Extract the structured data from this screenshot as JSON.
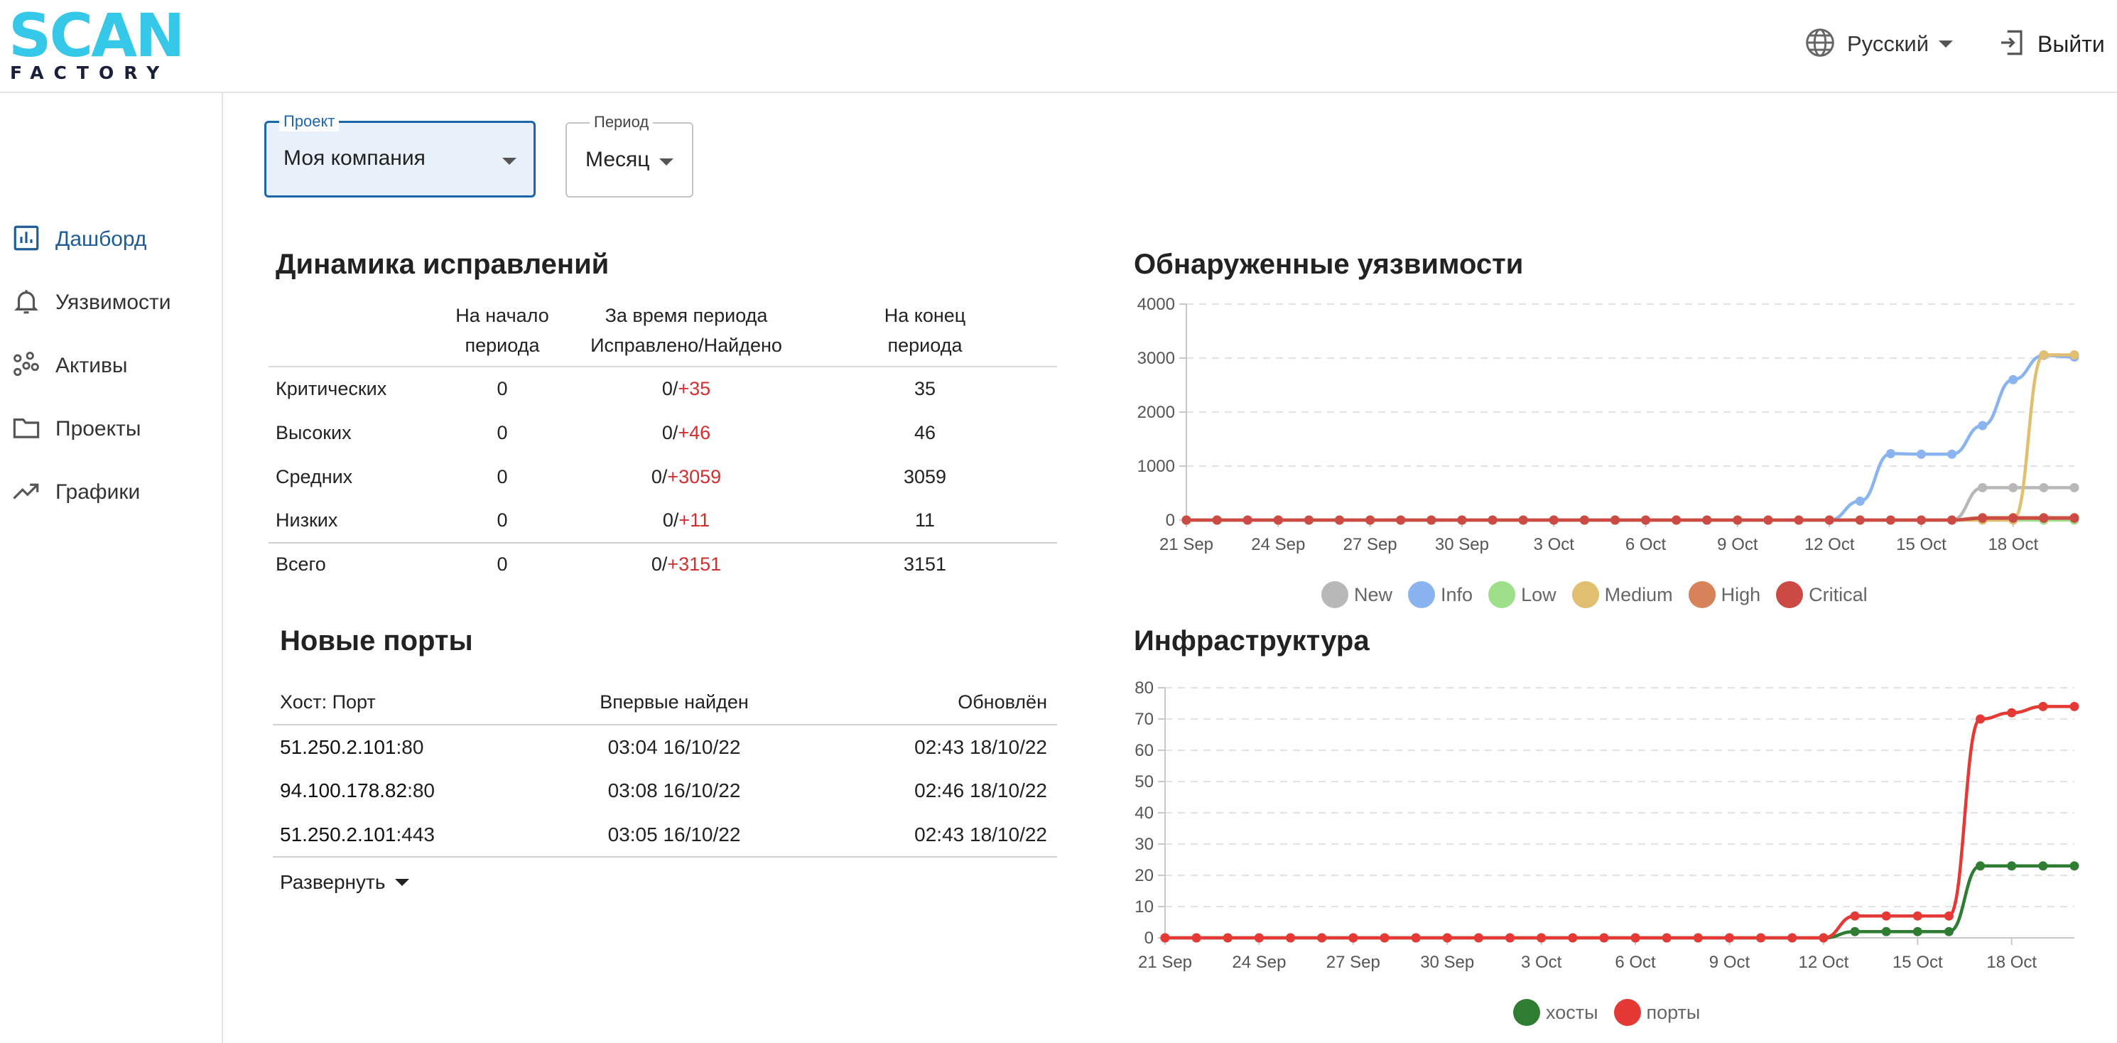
{
  "brand": {
    "name_top": "SCAN",
    "name_bottom": "FACTORY"
  },
  "header": {
    "language": "Русский",
    "logout": "Выйти"
  },
  "sidebar": {
    "items": [
      {
        "label": "Дашборд",
        "icon": "bar-chart-icon",
        "active": true
      },
      {
        "label": "Уязвимости",
        "icon": "bell-icon",
        "active": false
      },
      {
        "label": "Активы",
        "icon": "nodes-icon",
        "active": false
      },
      {
        "label": "Проекты",
        "icon": "folder-icon",
        "active": false
      },
      {
        "label": "Графики",
        "icon": "trending-up-icon",
        "active": false
      }
    ]
  },
  "filters": {
    "project": {
      "label": "Проект",
      "value": "Моя компания"
    },
    "period": {
      "label": "Период",
      "value": "Месяц"
    }
  },
  "remediation": {
    "title": "Динамика исправлений",
    "headers": {
      "start_line1": "На начало",
      "start_line2": "периода",
      "during_line1": "За время периода",
      "during_line2": "Исправлено/Найдено",
      "end_line1": "На конец",
      "end_line2": "периода"
    },
    "rows": [
      {
        "label": "Критических",
        "start": "0",
        "fixed": "0/",
        "found": "+35",
        "end": "35"
      },
      {
        "label": "Высоких",
        "start": "0",
        "fixed": "0/",
        "found": "+46",
        "end": "46"
      },
      {
        "label": "Средних",
        "start": "0",
        "fixed": "0/",
        "found": "+3059",
        "end": "3059"
      },
      {
        "label": "Низких",
        "start": "0",
        "fixed": "0/",
        "found": "+11",
        "end": "11"
      }
    ],
    "total": {
      "label": "Всего",
      "start": "0",
      "fixed": "0/",
      "found": "+3151",
      "end": "3151"
    }
  },
  "ports": {
    "title": "Новые порты",
    "headers": {
      "host_port": "Хост: Порт",
      "first_found": "Впервые найден",
      "updated": "Обновлён"
    },
    "rows": [
      {
        "host": "51.250.2.101",
        "port": ":80",
        "first_found": "03:04 16/10/22",
        "updated": "02:43 18/10/22"
      },
      {
        "host": "94.100.178.82",
        "port": ":80",
        "first_found": "03:08 16/10/22",
        "updated": "02:46 18/10/22"
      },
      {
        "host": "51.250.2.101",
        "port": ":443",
        "first_found": "03:05 16/10/22",
        "updated": "02:43 18/10/22"
      }
    ],
    "expand_label": "Развернуть"
  },
  "chart_data": [
    {
      "title": "Обнаруженные уязвимости",
      "type": "line",
      "x": [
        "21 Sep",
        "22 Sep",
        "23 Sep",
        "24 Sep",
        "25 Sep",
        "26 Sep",
        "27 Sep",
        "28 Sep",
        "29 Sep",
        "30 Sep",
        "1 Oct",
        "2 Oct",
        "3 Oct",
        "4 Oct",
        "5 Oct",
        "6 Oct",
        "7 Oct",
        "8 Oct",
        "9 Oct",
        "10 Oct",
        "11 Oct",
        "12 Oct",
        "13 Oct",
        "14 Oct",
        "15 Oct",
        "16 Oct",
        "17 Oct",
        "18 Oct",
        "19 Oct",
        "20 Oct"
      ],
      "xtick_labels": [
        "21 Sep",
        "24 Sep",
        "27 Sep",
        "30 Sep",
        "3 Oct",
        "6 Oct",
        "9 Oct",
        "12 Oct",
        "15 Oct",
        "18 Oct"
      ],
      "ylim": [
        0,
        4000
      ],
      "yticks": [
        0,
        1000,
        2000,
        3000,
        4000
      ],
      "grid": true,
      "legend_position": "bottom",
      "series": [
        {
          "name": "New",
          "color": "#b8b8b8",
          "values": [
            0,
            0,
            0,
            0,
            0,
            0,
            0,
            0,
            0,
            0,
            0,
            0,
            0,
            0,
            0,
            0,
            0,
            0,
            0,
            0,
            0,
            0,
            0,
            0,
            0,
            0,
            600,
            600,
            600,
            600
          ]
        },
        {
          "name": "Info",
          "color": "#8ab4f0",
          "values": [
            0,
            0,
            0,
            0,
            0,
            0,
            0,
            0,
            0,
            0,
            0,
            0,
            0,
            0,
            0,
            0,
            0,
            0,
            0,
            0,
            0,
            0,
            350,
            1230,
            1220,
            1220,
            1750,
            2600,
            3050,
            3020
          ]
        },
        {
          "name": "Low",
          "color": "#9ee08a",
          "values": [
            0,
            0,
            0,
            0,
            0,
            0,
            0,
            0,
            0,
            0,
            0,
            0,
            0,
            0,
            0,
            0,
            0,
            0,
            0,
            0,
            0,
            0,
            0,
            0,
            0,
            0,
            0,
            0,
            0,
            0
          ]
        },
        {
          "name": "Medium",
          "color": "#e0c070",
          "values": [
            0,
            0,
            0,
            0,
            0,
            0,
            0,
            0,
            0,
            0,
            0,
            0,
            0,
            0,
            0,
            0,
            0,
            0,
            0,
            0,
            0,
            0,
            0,
            0,
            0,
            0,
            0,
            0,
            3059,
            3059
          ]
        },
        {
          "name": "High",
          "color": "#d8825a",
          "values": [
            0,
            0,
            0,
            0,
            0,
            0,
            0,
            0,
            0,
            0,
            0,
            0,
            0,
            0,
            0,
            0,
            0,
            0,
            0,
            0,
            0,
            0,
            0,
            0,
            0,
            0,
            46,
            46,
            46,
            46
          ]
        },
        {
          "name": "Critical",
          "color": "#cc4a44",
          "values": [
            0,
            0,
            0,
            0,
            0,
            0,
            0,
            0,
            0,
            0,
            0,
            0,
            0,
            0,
            0,
            0,
            0,
            0,
            0,
            0,
            0,
            0,
            0,
            0,
            0,
            0,
            35,
            35,
            35,
            35
          ]
        }
      ]
    },
    {
      "title": "Инфраструктура",
      "type": "line",
      "x": [
        "21 Sep",
        "22 Sep",
        "23 Sep",
        "24 Sep",
        "25 Sep",
        "26 Sep",
        "27 Sep",
        "28 Sep",
        "29 Sep",
        "30 Sep",
        "1 Oct",
        "2 Oct",
        "3 Oct",
        "4 Oct",
        "5 Oct",
        "6 Oct",
        "7 Oct",
        "8 Oct",
        "9 Oct",
        "10 Oct",
        "11 Oct",
        "12 Oct",
        "13 Oct",
        "14 Oct",
        "15 Oct",
        "16 Oct",
        "17 Oct",
        "18 Oct",
        "19 Oct",
        "20 Oct"
      ],
      "xtick_labels": [
        "21 Sep",
        "24 Sep",
        "27 Sep",
        "30 Sep",
        "3 Oct",
        "6 Oct",
        "9 Oct",
        "12 Oct",
        "15 Oct",
        "18 Oct"
      ],
      "ylim": [
        0,
        80
      ],
      "yticks": [
        0,
        10,
        20,
        30,
        40,
        50,
        60,
        70,
        80
      ],
      "grid": true,
      "legend_position": "bottom",
      "series": [
        {
          "name": "хосты",
          "color": "#2e7d32",
          "values": [
            0,
            0,
            0,
            0,
            0,
            0,
            0,
            0,
            0,
            0,
            0,
            0,
            0,
            0,
            0,
            0,
            0,
            0,
            0,
            0,
            0,
            0,
            2,
            2,
            2,
            2,
            23,
            23,
            23,
            23
          ]
        },
        {
          "name": "порты",
          "color": "#e53935",
          "values": [
            0,
            0,
            0,
            0,
            0,
            0,
            0,
            0,
            0,
            0,
            0,
            0,
            0,
            0,
            0,
            0,
            0,
            0,
            0,
            0,
            0,
            0,
            7,
            7,
            7,
            7,
            70,
            72,
            74,
            74
          ]
        }
      ]
    }
  ]
}
